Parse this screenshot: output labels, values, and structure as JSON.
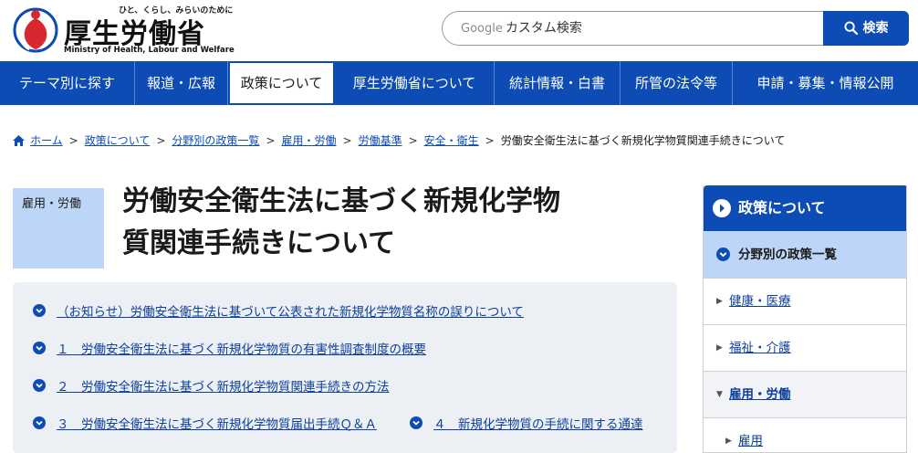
{
  "header": {
    "tagline": "ひと、くらし、みらいのために",
    "logo_title": "厚生労働省",
    "logo_subtitle": "Ministry of Health, Labour and Welfare"
  },
  "search": {
    "brand": "Google",
    "placeholder": "カスタム検索",
    "button_label": "検索"
  },
  "nav": {
    "items": [
      {
        "label": "テーマ別に探す"
      },
      {
        "label": "報道・広報"
      },
      {
        "label": "政策について"
      },
      {
        "label": "厚生労働省について"
      },
      {
        "label": "統計情報・白書"
      },
      {
        "label": "所管の法令等"
      },
      {
        "label": "申請・募集・情報公開"
      }
    ],
    "active_index": 2
  },
  "breadcrumb": {
    "items": [
      {
        "label": "ホーム"
      },
      {
        "label": "政策について"
      },
      {
        "label": "分野別の政策一覧"
      },
      {
        "label": "雇用・労働"
      },
      {
        "label": "労働基準"
      },
      {
        "label": "安全・衛生"
      }
    ],
    "current": "労働安全衛生法に基づく新規化学物質関連手続きについて",
    "separator": ">"
  },
  "category": "雇用・労働",
  "page_title_line1": "労働安全衛生法に基づく新規化学物",
  "page_title_line2": "質関連手続きについて",
  "anchors": [
    {
      "label": "（お知らせ）労働安全衛生法に基づいて公表された新規化学物質名称の誤りについて"
    },
    {
      "label": "１　労働安全衛生法に基づく新規化学物質の有害性調査制度の概要"
    },
    {
      "label": "２　労働安全衛生法に基づく新規化学物質関連手続きの方法"
    },
    {
      "label": "３　労働安全衛生法に基づく新規化学物質届出手続Ｑ＆Ａ"
    },
    {
      "label": "４　新規化学物質の手続に関する通達"
    }
  ],
  "sidebar": {
    "heading": "政策について",
    "sub_heading": "分野別の政策一覧",
    "items": [
      {
        "label": "健康・医療"
      },
      {
        "label": "福祉・介護"
      },
      {
        "label": "雇用・労働"
      },
      {
        "label": "雇用"
      }
    ]
  },
  "colors": {
    "brand_blue": "#0d4bb5",
    "light_blue": "#bdd5f6",
    "panel_gray": "#eceff3"
  }
}
